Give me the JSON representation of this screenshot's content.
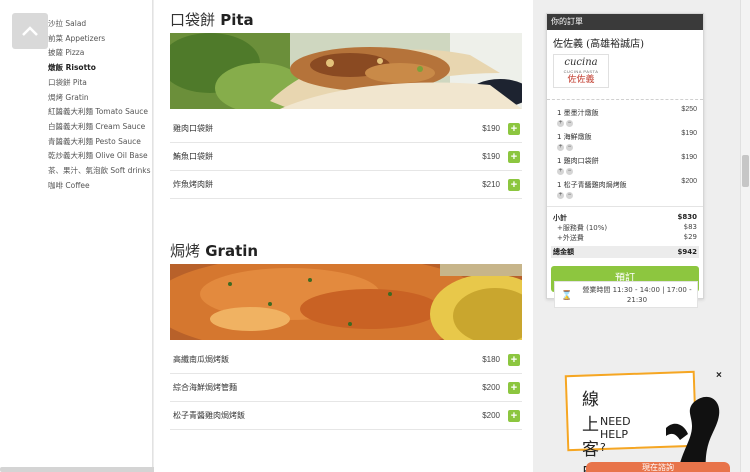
{
  "sidebar": {
    "back_to_top_icon": "chevron-up-icon",
    "categories": [
      {
        "label": "沙拉 Salad"
      },
      {
        "label": "前菜 Appetizers"
      },
      {
        "label": "披薩 Pizza"
      },
      {
        "label": "燉飯 Risotto"
      },
      {
        "label": "口袋餅 Pita"
      },
      {
        "label": "焗烤 Gratin"
      },
      {
        "label": "紅醬義大利麵 Tomato Sauce"
      },
      {
        "label": "白醬義大利麵 Cream Sauce"
      },
      {
        "label": "青醬義大利麵 Pesto Sauce"
      },
      {
        "label": "乾炒義大利麵 Olive Oil Base"
      },
      {
        "label": "茶、果汁、氣泡飲 Soft drinks"
      },
      {
        "label": "咖啡 Coffee"
      }
    ]
  },
  "sections": [
    {
      "title_cn": "口袋餅",
      "title_en": "Pita",
      "items": [
        {
          "name": "雞肉口袋餅",
          "price": "$190"
        },
        {
          "name": "鮪魚口袋餅",
          "price": "$190"
        },
        {
          "name": "炸魚烤肉餅",
          "price": "$210"
        }
      ]
    },
    {
      "title_cn": "焗烤",
      "title_en": "Gratin",
      "items": [
        {
          "name": "高纖南瓜焗烤飯",
          "price": "$180"
        },
        {
          "name": "綜合海鮮焗烤管麵",
          "price": "$200"
        },
        {
          "name": "松子青醬雞肉焗烤飯",
          "price": "$200"
        }
      ]
    }
  ],
  "add_symbol": "+",
  "order": {
    "header": "你的訂單",
    "store_name": "佐佐義 (高雄裕誠店)",
    "logo_line1": "cucina",
    "logo_line2": "CUCINA PASTA",
    "logo_line3": "佐佐義",
    "lines": [
      {
        "text": "1 墨墨汁燉飯",
        "amount": "$250"
      },
      {
        "text": "1 海鮮燉飯",
        "amount": "$190"
      },
      {
        "text": "1 雞肉口袋餅",
        "amount": "$190"
      },
      {
        "text": "1 松子青醬雞肉焗烤飯",
        "amount": "$200"
      }
    ],
    "qty_plus": "+",
    "qty_minus": "−",
    "subtotal_label": "小計",
    "subtotal": "$830",
    "service_label": "+服務費 (10%)",
    "service": "$83",
    "delivery_label": "+外送費",
    "delivery": "$29",
    "total_label": "總金額",
    "total": "$942",
    "button_label": "預訂",
    "hours_icon": "hourglass-icon",
    "hours_text": "營業時間 11:30 - 14:00 | 17:00 - 21:30"
  },
  "help": {
    "title_cn": "線上客服",
    "title_en": "NEED HELP ?",
    "close": "×",
    "chat_tab": "現在諮詢"
  },
  "colors": {
    "accent_green": "#8dc63f",
    "order_header": "#3a3a3a",
    "help_border": "#f5a623"
  }
}
